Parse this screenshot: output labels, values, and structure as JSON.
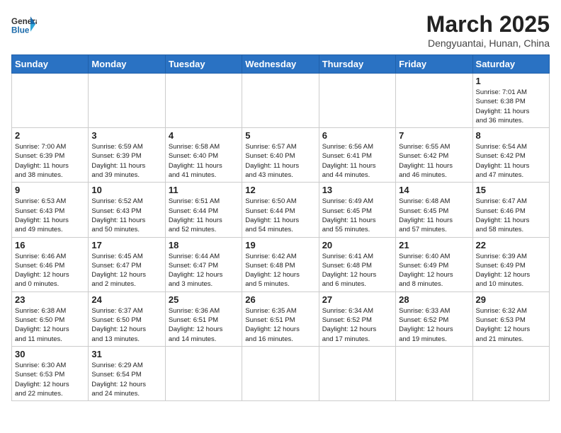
{
  "header": {
    "logo": {
      "general": "General",
      "blue": "Blue"
    },
    "title": "March 2025",
    "subtitle": "Dengyuantai, Hunan, China"
  },
  "weekdays": [
    "Sunday",
    "Monday",
    "Tuesday",
    "Wednesday",
    "Thursday",
    "Friday",
    "Saturday"
  ],
  "weeks": [
    [
      {
        "day": "",
        "info": ""
      },
      {
        "day": "",
        "info": ""
      },
      {
        "day": "",
        "info": ""
      },
      {
        "day": "",
        "info": ""
      },
      {
        "day": "",
        "info": ""
      },
      {
        "day": "",
        "info": ""
      },
      {
        "day": "1",
        "info": "Sunrise: 7:01 AM\nSunset: 6:38 PM\nDaylight: 11 hours\nand 36 minutes."
      }
    ],
    [
      {
        "day": "2",
        "info": "Sunrise: 7:00 AM\nSunset: 6:39 PM\nDaylight: 11 hours\nand 38 minutes."
      },
      {
        "day": "3",
        "info": "Sunrise: 6:59 AM\nSunset: 6:39 PM\nDaylight: 11 hours\nand 39 minutes."
      },
      {
        "day": "4",
        "info": "Sunrise: 6:58 AM\nSunset: 6:40 PM\nDaylight: 11 hours\nand 41 minutes."
      },
      {
        "day": "5",
        "info": "Sunrise: 6:57 AM\nSunset: 6:40 PM\nDaylight: 11 hours\nand 43 minutes."
      },
      {
        "day": "6",
        "info": "Sunrise: 6:56 AM\nSunset: 6:41 PM\nDaylight: 11 hours\nand 44 minutes."
      },
      {
        "day": "7",
        "info": "Sunrise: 6:55 AM\nSunset: 6:42 PM\nDaylight: 11 hours\nand 46 minutes."
      },
      {
        "day": "8",
        "info": "Sunrise: 6:54 AM\nSunset: 6:42 PM\nDaylight: 11 hours\nand 47 minutes."
      }
    ],
    [
      {
        "day": "9",
        "info": "Sunrise: 6:53 AM\nSunset: 6:43 PM\nDaylight: 11 hours\nand 49 minutes."
      },
      {
        "day": "10",
        "info": "Sunrise: 6:52 AM\nSunset: 6:43 PM\nDaylight: 11 hours\nand 50 minutes."
      },
      {
        "day": "11",
        "info": "Sunrise: 6:51 AM\nSunset: 6:44 PM\nDaylight: 11 hours\nand 52 minutes."
      },
      {
        "day": "12",
        "info": "Sunrise: 6:50 AM\nSunset: 6:44 PM\nDaylight: 11 hours\nand 54 minutes."
      },
      {
        "day": "13",
        "info": "Sunrise: 6:49 AM\nSunset: 6:45 PM\nDaylight: 11 hours\nand 55 minutes."
      },
      {
        "day": "14",
        "info": "Sunrise: 6:48 AM\nSunset: 6:45 PM\nDaylight: 11 hours\nand 57 minutes."
      },
      {
        "day": "15",
        "info": "Sunrise: 6:47 AM\nSunset: 6:46 PM\nDaylight: 11 hours\nand 58 minutes."
      }
    ],
    [
      {
        "day": "16",
        "info": "Sunrise: 6:46 AM\nSunset: 6:46 PM\nDaylight: 12 hours\nand 0 minutes."
      },
      {
        "day": "17",
        "info": "Sunrise: 6:45 AM\nSunset: 6:47 PM\nDaylight: 12 hours\nand 2 minutes."
      },
      {
        "day": "18",
        "info": "Sunrise: 6:44 AM\nSunset: 6:47 PM\nDaylight: 12 hours\nand 3 minutes."
      },
      {
        "day": "19",
        "info": "Sunrise: 6:42 AM\nSunset: 6:48 PM\nDaylight: 12 hours\nand 5 minutes."
      },
      {
        "day": "20",
        "info": "Sunrise: 6:41 AM\nSunset: 6:48 PM\nDaylight: 12 hours\nand 6 minutes."
      },
      {
        "day": "21",
        "info": "Sunrise: 6:40 AM\nSunset: 6:49 PM\nDaylight: 12 hours\nand 8 minutes."
      },
      {
        "day": "22",
        "info": "Sunrise: 6:39 AM\nSunset: 6:49 PM\nDaylight: 12 hours\nand 10 minutes."
      }
    ],
    [
      {
        "day": "23",
        "info": "Sunrise: 6:38 AM\nSunset: 6:50 PM\nDaylight: 12 hours\nand 11 minutes."
      },
      {
        "day": "24",
        "info": "Sunrise: 6:37 AM\nSunset: 6:50 PM\nDaylight: 12 hours\nand 13 minutes."
      },
      {
        "day": "25",
        "info": "Sunrise: 6:36 AM\nSunset: 6:51 PM\nDaylight: 12 hours\nand 14 minutes."
      },
      {
        "day": "26",
        "info": "Sunrise: 6:35 AM\nSunset: 6:51 PM\nDaylight: 12 hours\nand 16 minutes."
      },
      {
        "day": "27",
        "info": "Sunrise: 6:34 AM\nSunset: 6:52 PM\nDaylight: 12 hours\nand 17 minutes."
      },
      {
        "day": "28",
        "info": "Sunrise: 6:33 AM\nSunset: 6:52 PM\nDaylight: 12 hours\nand 19 minutes."
      },
      {
        "day": "29",
        "info": "Sunrise: 6:32 AM\nSunset: 6:53 PM\nDaylight: 12 hours\nand 21 minutes."
      }
    ],
    [
      {
        "day": "30",
        "info": "Sunrise: 6:30 AM\nSunset: 6:53 PM\nDaylight: 12 hours\nand 22 minutes."
      },
      {
        "day": "31",
        "info": "Sunrise: 6:29 AM\nSunset: 6:54 PM\nDaylight: 12 hours\nand 24 minutes."
      },
      {
        "day": "",
        "info": ""
      },
      {
        "day": "",
        "info": ""
      },
      {
        "day": "",
        "info": ""
      },
      {
        "day": "",
        "info": ""
      },
      {
        "day": "",
        "info": ""
      }
    ]
  ]
}
